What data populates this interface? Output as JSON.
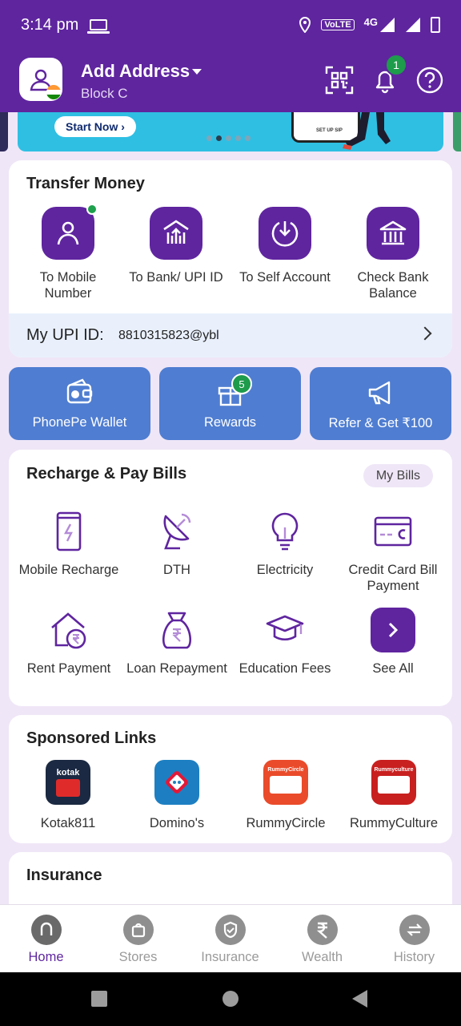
{
  "status_bar": {
    "time": "3:14 pm",
    "volte": "VoLTE",
    "network": "4G"
  },
  "header": {
    "title": "Add Address",
    "subtitle": "Block C",
    "notification_count": "1"
  },
  "banner": {
    "cta": "Start Now ›",
    "phone_text": "SET UP SIP"
  },
  "transfer_money": {
    "title": "Transfer Money",
    "items": [
      {
        "label": "To Mobile Number",
        "icon": "person-icon"
      },
      {
        "label": "To Bank/ UPI ID",
        "icon": "bank-upload-icon"
      },
      {
        "label": "To Self Account",
        "icon": "self-transfer-icon"
      },
      {
        "label": "Check Bank Balance",
        "icon": "bank-icon"
      }
    ],
    "upi_label": "My UPI ID:",
    "upi_value": "8810315823@ybl"
  },
  "quick_actions": [
    {
      "label": "PhonePe Wallet",
      "icon": "wallet-icon"
    },
    {
      "label": "Rewards",
      "icon": "gift-icon",
      "badge": "5"
    },
    {
      "label": "Refer & Get ₹100",
      "icon": "megaphone-icon"
    }
  ],
  "recharge": {
    "title": "Recharge & Pay Bills",
    "my_bills": "My Bills",
    "items": [
      {
        "label": "Mobile Recharge",
        "icon": "mobile-icon"
      },
      {
        "label": "DTH",
        "icon": "satellite-dish-icon"
      },
      {
        "label": "Electricity",
        "icon": "bulb-icon"
      },
      {
        "label": "Credit Card Bill Payment",
        "icon": "credit-card-icon"
      },
      {
        "label": "Rent Payment",
        "icon": "house-rupee-icon"
      },
      {
        "label": "Loan Repayment",
        "icon": "money-bag-icon"
      },
      {
        "label": "Education Fees",
        "icon": "graduation-cap-icon"
      },
      {
        "label": "See All",
        "icon": "chevron-right-icon"
      }
    ]
  },
  "sponsored": {
    "title": "Sponsored Links",
    "items": [
      {
        "label": "Kotak811",
        "logo_text": "kotak"
      },
      {
        "label": "Domino's"
      },
      {
        "label": "RummyCircle",
        "logo_text": "RummyCircle"
      },
      {
        "label": "RummyCulture",
        "logo_text": "Rummyculture"
      }
    ]
  },
  "insurance": {
    "title": "Insurance"
  },
  "bottom_nav": [
    {
      "label": "Home",
      "active": true
    },
    {
      "label": "Stores"
    },
    {
      "label": "Insurance"
    },
    {
      "label": "Wealth"
    },
    {
      "label": "History"
    }
  ],
  "colors": {
    "brand": "#5f259f",
    "tile_blue": "#4f7dd1",
    "success": "#1e9b4b"
  }
}
